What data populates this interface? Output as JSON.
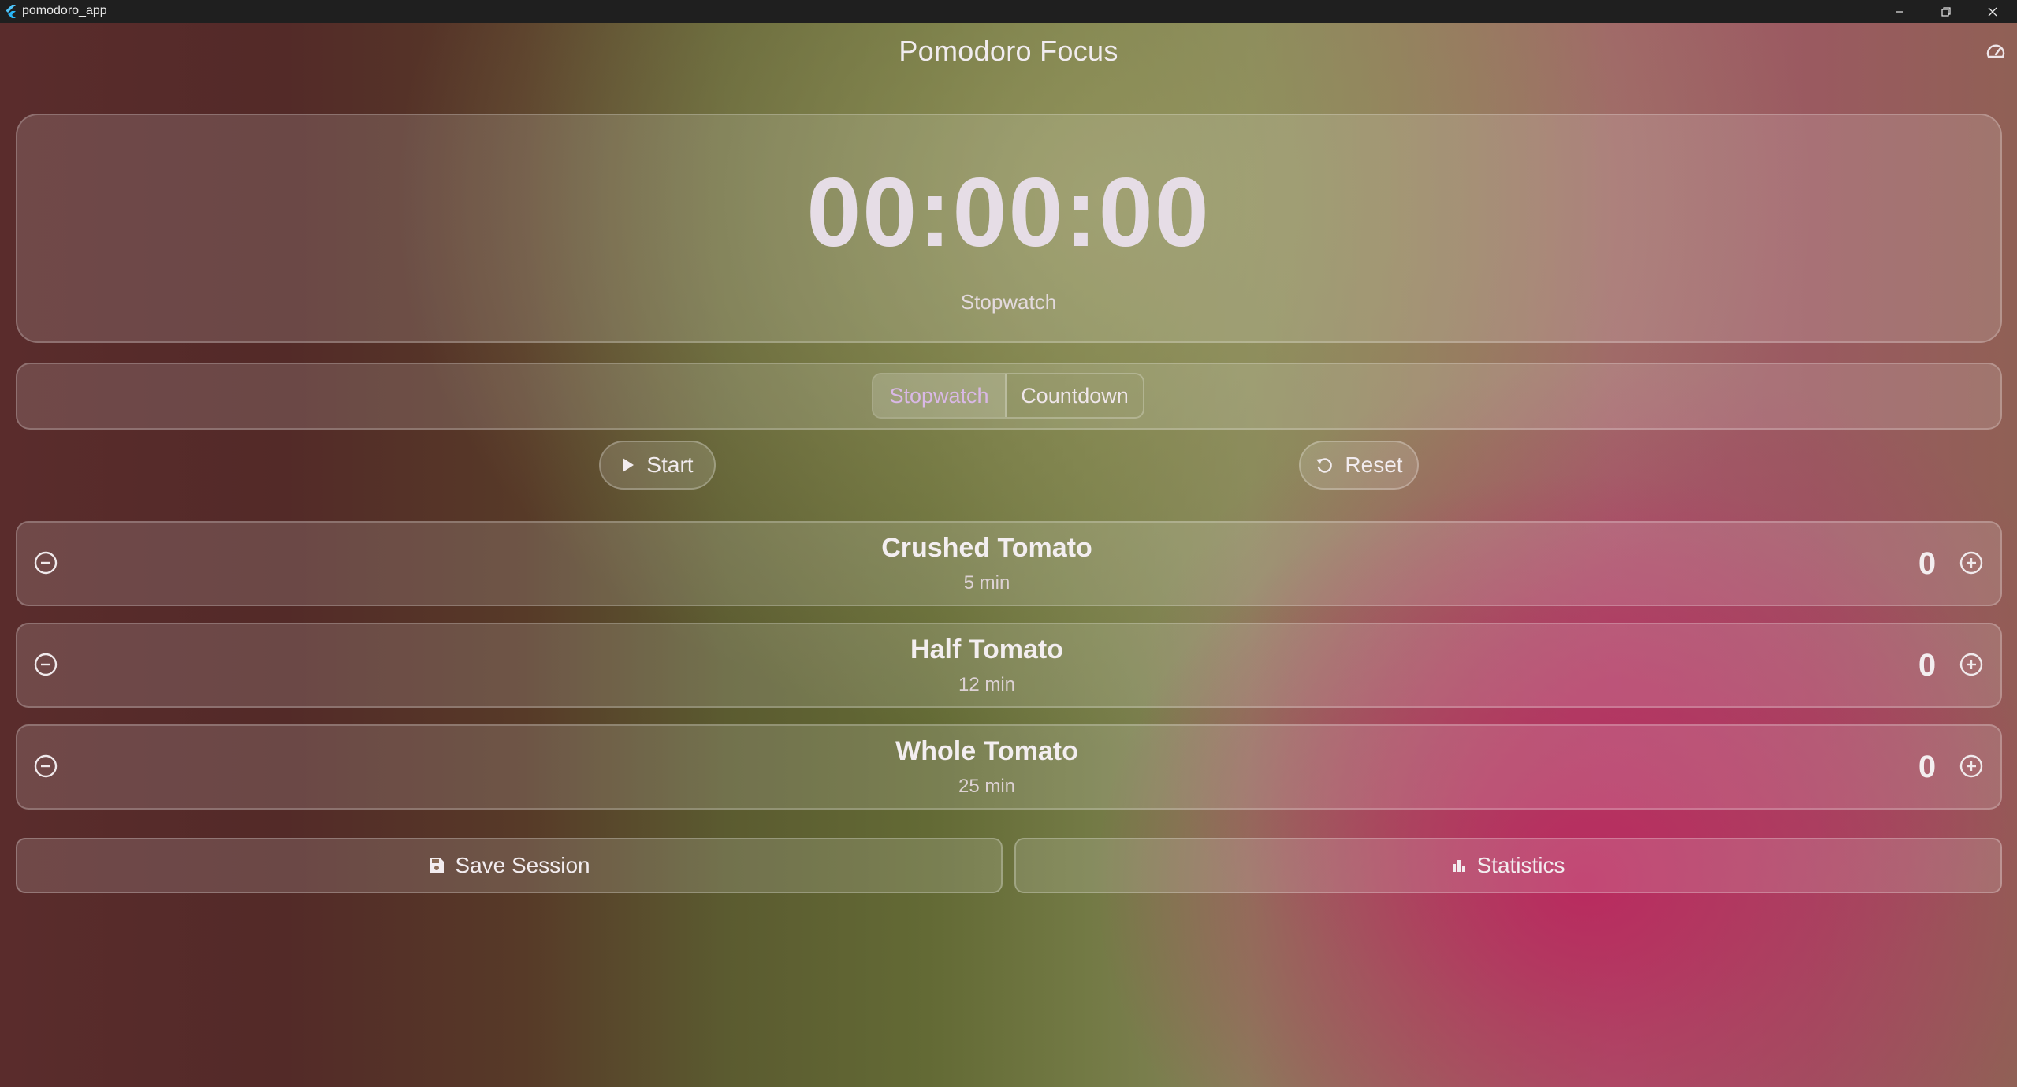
{
  "window": {
    "title": "pomodoro_app"
  },
  "header": {
    "title": "Pomodoro Focus"
  },
  "timer": {
    "display": "00:00:00",
    "mode_label": "Stopwatch"
  },
  "mode_selector": {
    "options": [
      "Stopwatch",
      "Countdown"
    ],
    "selected": "Stopwatch"
  },
  "controls": {
    "start_label": "Start",
    "reset_label": "Reset"
  },
  "tomatoes": [
    {
      "name": "Crushed Tomato",
      "duration": "5 min",
      "count": "0"
    },
    {
      "name": "Half Tomato",
      "duration": "12 min",
      "count": "0"
    },
    {
      "name": "Whole Tomato",
      "duration": "25 min",
      "count": "0"
    }
  ],
  "actions": {
    "save_label": "Save Session",
    "stats_label": "Statistics"
  },
  "colors": {
    "accent_selected": "#d9b8e6",
    "text": "#f2ecef",
    "titlebar": "#1f1f1f"
  }
}
